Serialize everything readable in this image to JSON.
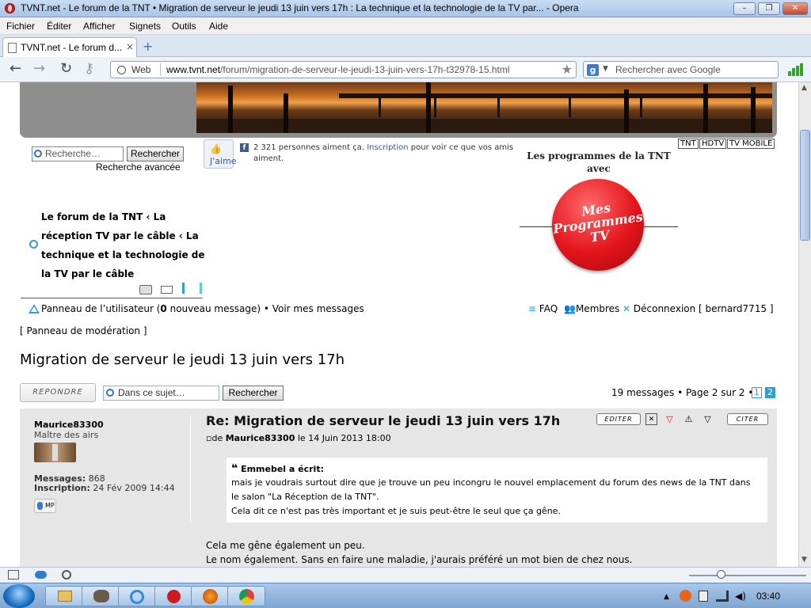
{
  "window": {
    "title": "TVNT.net - Le forum de la TNT • Migration de serveur le jeudi 13 juin vers 17h : La technique et la technologie de la TV par... - Opera",
    "minimize": "–",
    "maximize": "❐",
    "close": "✕"
  },
  "menu": [
    "Fichier",
    "Éditer",
    "Afficher",
    "Signets",
    "Outils",
    "Aide"
  ],
  "tab": {
    "label": "TVNT.net - Le forum d...",
    "close": "×",
    "new": "+"
  },
  "address": {
    "mode": "Web",
    "domain": "www.tvnt.net",
    "path": "/forum/migration-de-serveur-le-jeudi-13-juin-vers-17h-t32978-15.html",
    "search_placeholder": "Rechercher avec Google",
    "search_engine": "g"
  },
  "header": {
    "search_placeholder": "Recherche…",
    "search_button": "Rechercher",
    "advanced": "Recherche avancée",
    "like_label": "J'aime",
    "like_icon": "👍",
    "fb_letter": "f",
    "fb_count": "2 321 personnes aiment ça.",
    "fb_link": "Inscription",
    "fb_rest": "pour voir ce que vos amis aiment.",
    "tags": [
      "TNT",
      "HDTV",
      "TV MOBILE"
    ],
    "mesprog_title": "Les programmes de la TNT avec",
    "mesprog_logo": "Mes Programmes TV"
  },
  "breadcrumb": "Le forum de la TNT ‹ La réception TV par le câble ‹ La technique et la technologie de la TV par le câble",
  "userbar": {
    "panel": "Panneau de l’utilisateur (",
    "count": "0",
    "panel_rest": " nouveau message) • Voir mes messages",
    "faq": "FAQ",
    "members": "Membres",
    "logout": "Déconnexion [ bernard7715 ]",
    "modpanel": "[ Panneau de modération ]"
  },
  "topic": {
    "title": "Migration de serveur le jeudi 13 juin vers 17h",
    "reply": "REPONDRE",
    "search_placeholder": "Dans ce sujet…",
    "search_button": "Rechercher",
    "pageinfo": "19 messages • Page 2 sur 2 •",
    "pages": [
      "1",
      "2"
    ]
  },
  "post": {
    "author": "Maurice83300",
    "rank": "Maître des airs",
    "messages_label": "Messages:",
    "messages": "868",
    "joined_label": "Inscription:",
    "joined": "24 Fév 2009 14:44",
    "pm": "MP",
    "title": "Re: Migration de serveur le jeudi 13 juin vers 17h",
    "meta_prefix": "de",
    "meta_author": "Maurice83300",
    "meta_date": "le 14 Juin 2013 18:00",
    "edit": "EDITER",
    "quote_btn": "CITER",
    "quote_head": "Emmebel a écrit:",
    "quote_lines": [
      "mais je voudrais surtout dire que je trouve un peu incongru le nouvel emplacement du forum des news de la TNT dans",
      "le salon \"La Réception de la TNT\".",
      "Cela dit ce n'est pas très important et je suis peut-être le seul que ça gêne."
    ],
    "body_lines": [
      "Cela me gêne également un peu.",
      "Le nom également. Sans en faire une maladie, j'aurais préféré un mot bien de chez nous."
    ]
  },
  "taskbar": {
    "clock": "03:40"
  }
}
